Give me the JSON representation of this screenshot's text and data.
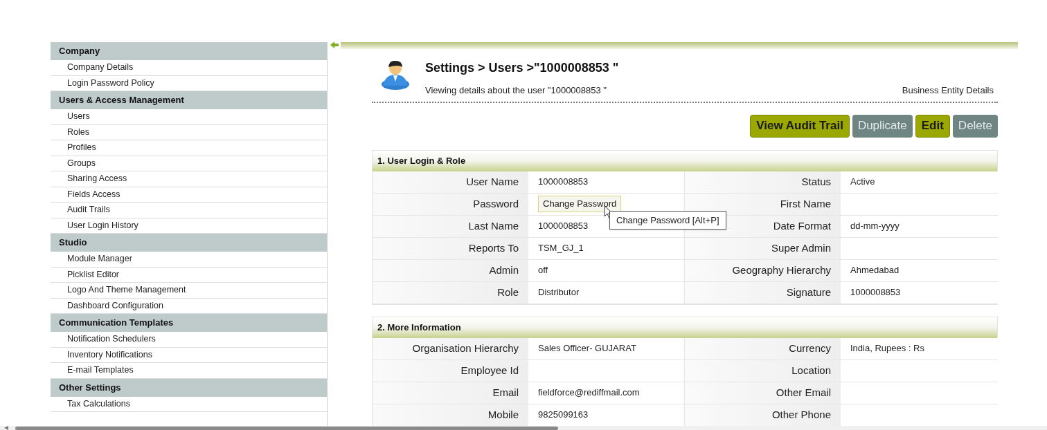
{
  "sidebar": {
    "groups": [
      {
        "title": "Company",
        "items": [
          {
            "label": "Company Details"
          },
          {
            "label": "Login Password Policy"
          }
        ]
      },
      {
        "title": "Users & Access Management",
        "items": [
          {
            "label": "Users"
          },
          {
            "label": "Roles"
          },
          {
            "label": "Profiles"
          },
          {
            "label": "Groups"
          },
          {
            "label": "Sharing Access"
          },
          {
            "label": "Fields Access"
          },
          {
            "label": "Audit Trails"
          },
          {
            "label": "User Login History"
          }
        ]
      },
      {
        "title": "Studio",
        "items": [
          {
            "label": "Module Manager"
          },
          {
            "label": "Picklist Editor"
          },
          {
            "label": "Logo And Theme Management"
          },
          {
            "label": "Dashboard Configuration"
          }
        ]
      },
      {
        "title": "Communication Templates",
        "items": [
          {
            "label": "Notification Schedulers"
          },
          {
            "label": "Inventory Notifications"
          },
          {
            "label": "E-mail Templates"
          }
        ]
      },
      {
        "title": "Other Settings",
        "items": [
          {
            "label": "Tax Calculations"
          }
        ]
      }
    ]
  },
  "header": {
    "title": "Settings > Users >\"1000008853 \"",
    "subtitle": "Viewing details about the user \"1000008853 \"",
    "link": "Business Entity Details"
  },
  "buttons": [
    {
      "label": "View Audit Trail",
      "disabled": false
    },
    {
      "label": "Duplicate",
      "disabled": true
    },
    {
      "label": "Edit",
      "disabled": false
    },
    {
      "label": "Delete",
      "disabled": true
    }
  ],
  "sections": [
    {
      "title": "1. User Login & Role",
      "rows": [
        {
          "label": "User Name",
          "value": {
            "kind": "text",
            "text": "1000008853"
          },
          "label_2": "Status",
          "value_2": "Active"
        },
        {
          "label": "Password",
          "value": {
            "kind": "button",
            "text": "Change Password"
          },
          "label_2": "First Name"
        },
        {
          "label": "Last Name",
          "value": {
            "kind": "text",
            "text": "1000008853"
          },
          "label_2": "Date Format",
          "value_2": "dd-mm-yyyy"
        },
        {
          "label": "Reports To",
          "value": {
            "kind": "text",
            "text": "TSM_GJ_1"
          },
          "label_2": "Super Admin"
        },
        {
          "label": "Admin",
          "value": {
            "kind": "text",
            "text": "off"
          },
          "label_2": "Geography Hierarchy",
          "value_2": "Ahmedabad"
        },
        {
          "label": "Role",
          "value": {
            "kind": "text",
            "text": "Distributor"
          },
          "label_2": "Signature",
          "value_2": "1000008853"
        }
      ]
    },
    {
      "title": "2. More Information",
      "rows": [
        {
          "label": "Organisation Hierarchy",
          "value": {
            "kind": "text",
            "text": "Sales Officer- GUJARAT"
          },
          "label_2": "Currency",
          "value_2": "India, Rupees : Rs"
        },
        {
          "label": "Employee Id",
          "value": {
            "kind": "text"
          },
          "label_2": "Location"
        },
        {
          "label": "Email",
          "value": {
            "kind": "text",
            "text": "fieldforce@rediffmail.com"
          },
          "label_2": "Other Email"
        },
        {
          "label": "Mobile",
          "value": {
            "kind": "text",
            "text": "9825099163"
          },
          "label_2": "Other Phone"
        }
      ]
    }
  ],
  "tooltip": {
    "text": "Change Password [Alt+P]"
  }
}
